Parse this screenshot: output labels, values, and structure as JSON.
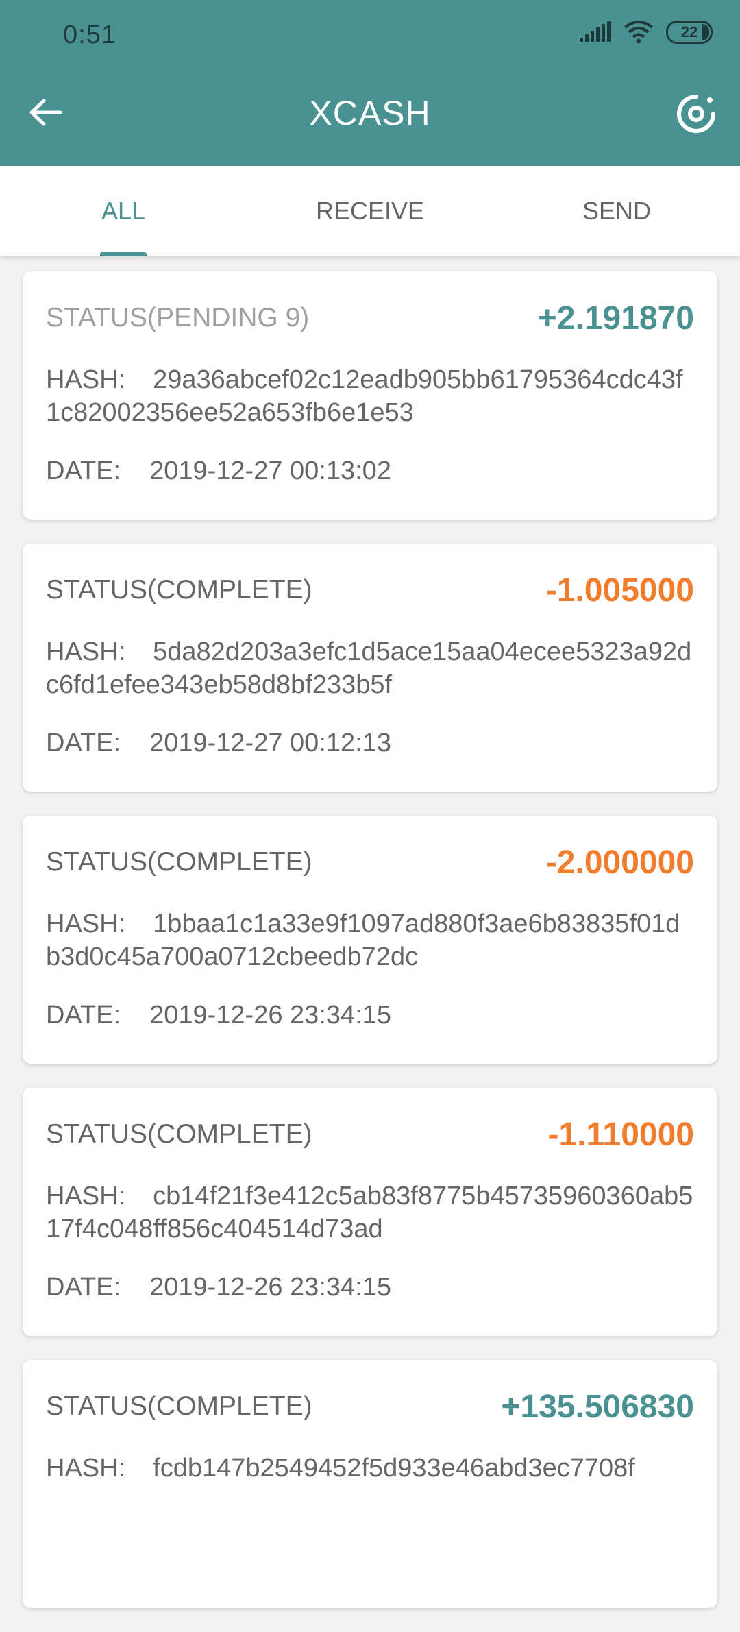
{
  "status_bar": {
    "time": "0:51",
    "battery": "22"
  },
  "header": {
    "title": "XCASH"
  },
  "tabs": [
    {
      "label": "ALL",
      "active": true
    },
    {
      "label": "RECEIVE",
      "active": false
    },
    {
      "label": "SEND",
      "active": false
    }
  ],
  "labels": {
    "hash": "HASH:",
    "date": "DATE:"
  },
  "transactions": [
    {
      "status": "STATUS(PENDING 9)",
      "amount": "+2.191870",
      "hash": "29a36abcef02c12eadb905bb61795364cdc43f1c82002356ee52a653fb6e1e53",
      "date": "2019-12-27 00:13:02"
    },
    {
      "status": "STATUS(COMPLETE)",
      "amount": "-1.005000",
      "hash": "5da82d203a3efc1d5ace15aa04ecee5323a92dc6fd1efee343eb58d8bf233b5f",
      "date": "2019-12-27 00:12:13"
    },
    {
      "status": "STATUS(COMPLETE)",
      "amount": "-2.000000",
      "hash": "1bbaa1c1a33e9f1097ad880f3ae6b83835f01db3d0c45a700a0712cbeedb72dc",
      "date": "2019-12-26 23:34:15"
    },
    {
      "status": "STATUS(COMPLETE)",
      "amount": "-1.110000",
      "hash": "cb14f21f3e412c5ab83f8775b45735960360ab517f4c048ff856c404514d73ad",
      "date": "2019-12-26 23:34:15"
    },
    {
      "status": "STATUS(COMPLETE)",
      "amount": "+135.506830",
      "hash": "fcdb147b2549452f5d933e46abd3ec7708f",
      "date": ""
    }
  ],
  "colors": {
    "primary": "#4a9191",
    "positive": "#4a9191",
    "negative": "#f07c2c"
  }
}
